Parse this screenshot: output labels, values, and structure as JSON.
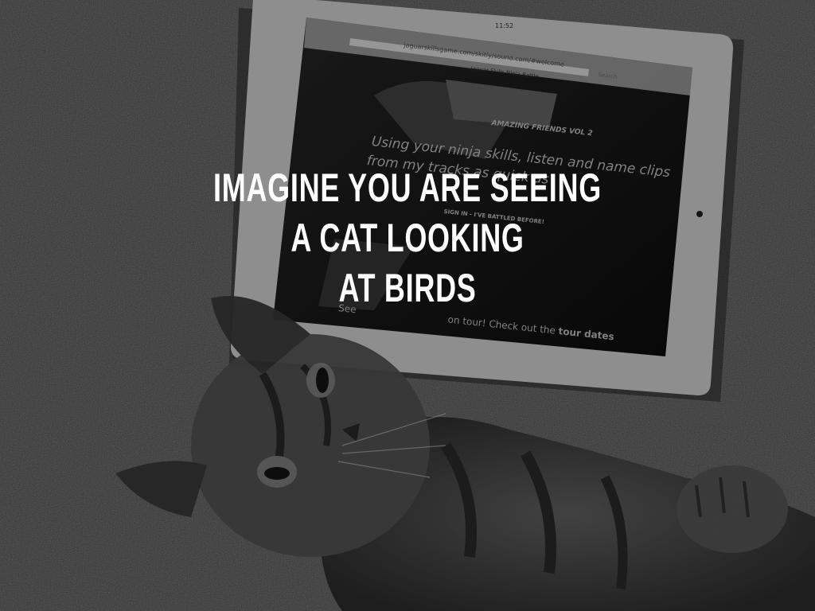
{
  "caption": {
    "lines": [
      "IMAGINE YOU ARE SEEING",
      "A CAT LOOKING",
      "AT BIRDS"
    ]
  },
  "tablet_screen": {
    "status_time": "11:52",
    "url": "jaguarskillsgame.com/skitly/sound.com/#welcome",
    "page_tab": "Jaguar Skills Ninja Battle",
    "search_placeholder": "Search",
    "subtitle": "AMAZING FRIENDS",
    "subtitle_vol": "VOL 2",
    "line1": "Using your ninja skills, listen and name clips",
    "line2": "from my tracks as quick as",
    "sign_in": "SIGN IN - I'VE BATTLED BEFORE!",
    "footer_prefix": "See",
    "footer_text": "on tour! Check out the",
    "footer_link": "tour dates"
  },
  "colors": {
    "carpet": "#4a4a4a",
    "tablet_frame": "#e8e8e8",
    "screen": "#1a1a1a",
    "caption_text": "#ffffff"
  }
}
